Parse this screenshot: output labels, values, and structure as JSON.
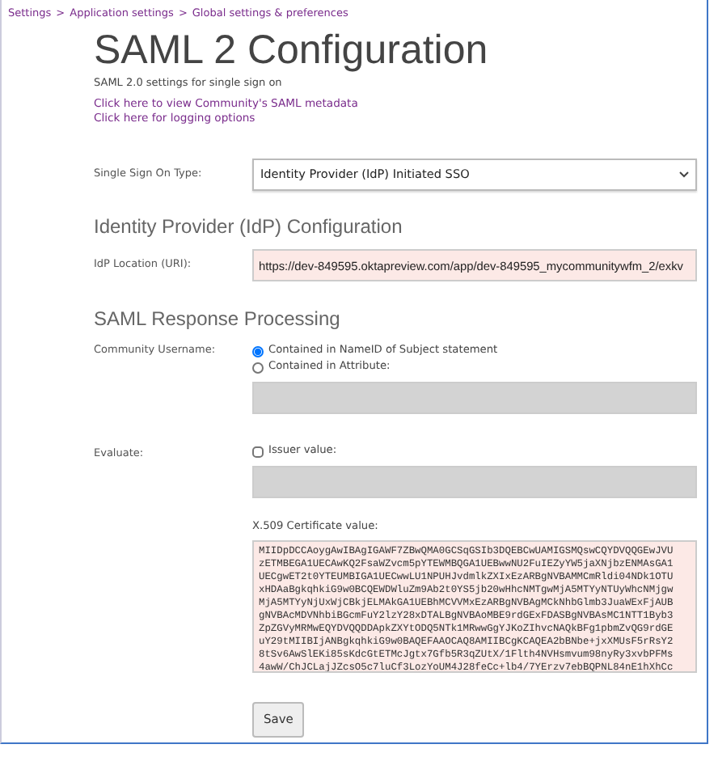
{
  "breadcrumb": [
    "Settings",
    "Application settings",
    "Global settings & preferences"
  ],
  "breadcrumb_separator": ">",
  "title": "SAML 2 Configuration",
  "subtitle": "SAML 2.0 settings for single sign on",
  "links": [
    "Click here to view Community's SAML metadata",
    "Click here for logging options"
  ],
  "sso_type": {
    "label": "Single Sign On Type:",
    "value": "Identity Provider (IdP) Initiated SSO"
  },
  "idp_section": {
    "heading": "Identity Provider (IdP) Configuration",
    "label": "IdP Location (URI):",
    "value": "https://dev-849595.oktapreview.com/app/dev-849595_mycommunitywfm_2/exkv"
  },
  "response_section": {
    "heading": "SAML Response Processing",
    "username": {
      "label": "Community Username:",
      "options": [
        {
          "label": "Contained in NameID of Subject statement",
          "selected": true
        },
        {
          "label": "Contained in Attribute:",
          "selected": false
        }
      ],
      "attribute_disabled": true
    },
    "evaluate": {
      "label": "Evaluate:",
      "option": {
        "label": "Issuer value:",
        "checked": false
      },
      "issuer_disabled": true
    },
    "certificate": {
      "label": "X.509 Certificate value:",
      "lines": [
        "MIIDpDCCAoygAwIBAgIGAWF7ZBwQMA0GCSqGSIb3DQEBCwUAMIGSMQswCQYDVQQGEwJVU",
        "zETMBEGA1UECAwKQ2FsaWZvcm5pYTEWMBQGA1UEBwwNU2FuIEZyYW5jaXNjbzENMAsGA1",
        "UECgwET2t0YTEUMBIGA1UECwwLU1NPUHJvdmlkZXIxEzARBgNVBAMMCmRldi04NDk1OTU",
        "xHDAaBgkqhkiG9w0BCQEWDWluZm9Ab2t0YS5jb20wHhcNMTgwMjA5MTYyNTUyWhcNMjgw",
        "MjA5MTYyNjUxWjCBkjELMAkGA1UEBhMCVVMxEzARBgNVBAgMCkNhbGlmb3JuaWExFjAUB",
        "gNVBAcMDVNhbiBGcmFuY2lzY28xDTALBgNVBAoMBE9rdGExFDASBgNVBAsMC1NTT1Byb3",
        "ZpZGVyMRMwEQYDVQQDDApkZXYtODQ5NTk1MRwwGgYJKoZIhvcNAQkBFg1pbmZvQG9rdGE",
        "uY29tMIIBIjANBgkqhkiG9w0BAQEFAAOCAQ8AMIIBCgKCAQEA2bBNbe+jxXMUsF5rRsY2",
        "8tSv6AwSlEKi85sKdcGtETMcJgtx7Gfb5R3qZUtX/1Flth4NVHsmvum98nyRy3xvbPFMs",
        "4awW/ChJCLajJZcsO5c7luCf3LozYoUM4J28feCc+lb4/7YErzv7ebBQPNL84nE1hXhCc"
      ]
    }
  },
  "save_button": "Save"
}
